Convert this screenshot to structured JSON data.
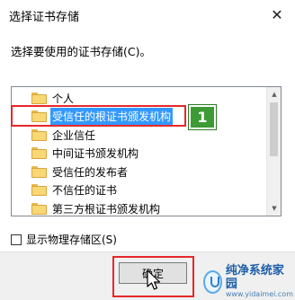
{
  "window": {
    "title": "选择证书存储",
    "close_glyph": "✕"
  },
  "prompt": "选择要使用的证书存储(C)。",
  "tree": {
    "items": [
      {
        "label": "个人",
        "selected": false
      },
      {
        "label": "受信任的根证书颁发机构",
        "selected": true
      },
      {
        "label": "企业信任",
        "selected": false
      },
      {
        "label": "中间证书颁发机构",
        "selected": false
      },
      {
        "label": "受信任的发布者",
        "selected": false
      },
      {
        "label": "不信任的证书",
        "selected": false
      },
      {
        "label": "第三方根证书颁发机构",
        "selected": false
      }
    ],
    "scroll_up_glyph": "▲",
    "scroll_down_glyph": "▼"
  },
  "annotation": {
    "step_number": "1",
    "highlight_color": "#e8272a",
    "badge_color": "#3d9b35"
  },
  "checkbox": {
    "label": "显示物理存储区(S)",
    "checked": false
  },
  "ok_button": {
    "label": "确定"
  },
  "watermark": {
    "name": "纯净系统家园",
    "url": "www.yidaimei.com"
  }
}
